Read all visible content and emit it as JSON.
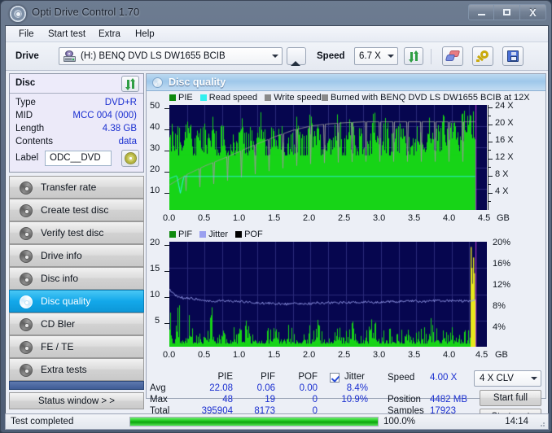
{
  "window": {
    "title": "Opti Drive Control 1.70",
    "icon": "disc-icon",
    "controls": {
      "minimize": "–",
      "maximize": "□",
      "close": "X"
    }
  },
  "menu": {
    "items": [
      "File",
      "Start test",
      "Extra",
      "Help"
    ]
  },
  "toolbar": {
    "drive_label": "Drive",
    "drive_value": "(H:)   BENQ DVD LS DW1655 BCIB",
    "eject_title": "Eject",
    "speed_label": "Speed",
    "speed_value": "6.7 X",
    "refresh_title": "Refresh",
    "erase_title": "Erase disc",
    "key_title": "Drive settings",
    "save_title": "Save"
  },
  "disc_panel": {
    "title": "Disc",
    "refresh_title": "Refresh disc info",
    "rows": [
      {
        "label": "Type",
        "value": "DVD+R"
      },
      {
        "label": "MID",
        "value": "MCC 004 (000)"
      },
      {
        "label": "Length",
        "value": "4.38 GB"
      },
      {
        "label": "Contents",
        "value": "data"
      }
    ],
    "label_caption": "Label",
    "label_value": "ODC__DVD",
    "disc_icon_title": "Disc icon"
  },
  "sidebar": {
    "items": [
      {
        "label": "Transfer rate",
        "selected": false
      },
      {
        "label": "Create test disc",
        "selected": false
      },
      {
        "label": "Verify test disc",
        "selected": false
      },
      {
        "label": "Drive info",
        "selected": false
      },
      {
        "label": "Disc info",
        "selected": false
      },
      {
        "label": "Disc quality",
        "selected": true
      },
      {
        "label": "CD Bler",
        "selected": false
      },
      {
        "label": "FE / TE",
        "selected": false
      },
      {
        "label": "Extra tests",
        "selected": false
      }
    ],
    "status_window_button": "Status window > >"
  },
  "panel": {
    "title": "Disc quality"
  },
  "stats": {
    "columns": [
      "PIE",
      "PIF",
      "POF",
      "Jitter"
    ],
    "jitter_checked": true,
    "rows": [
      {
        "label": "Avg",
        "values": [
          "22.08",
          "0.06",
          "0.00",
          "8.4%"
        ]
      },
      {
        "label": "Max",
        "values": [
          "48",
          "19",
          "0",
          "10.9%"
        ]
      },
      {
        "label": "Total",
        "values": [
          "395904",
          "8173",
          "0",
          ""
        ]
      }
    ],
    "info": [
      {
        "label": "Speed",
        "value": "4.00 X"
      },
      {
        "label": "Position",
        "value": "4482 MB"
      },
      {
        "label": "Samples",
        "value": "17923"
      }
    ],
    "speed_select": "4 X CLV",
    "start_full": "Start full",
    "start_part": "Start part"
  },
  "statusbar": {
    "message": "Test completed",
    "progress_text": "100.0%",
    "progress_value": 100,
    "time": "14:14"
  },
  "colors": {
    "pie": "#17d417",
    "read_speed": "#31f0ef",
    "write_speed": "#9a9a9a",
    "pif": "#17d417",
    "jitter": "#9aa0f0",
    "pof": "#000000",
    "plot_bg": "#06064f",
    "accent_blue": "#1a2fd0",
    "selection": "#13a8ea"
  },
  "chart_data": [
    {
      "type": "line",
      "title": "PIE / Read speed / Write speed",
      "legend": [
        {
          "name": "PIE",
          "color": "#17d417"
        },
        {
          "name": "Read speed",
          "color": "#31f0ef"
        },
        {
          "name": "Write speed",
          "color": "#9a9a9a"
        },
        {
          "name": "Burned with BENQ DVD LS DW1655 BCIB at 12X",
          "color": "#9a9a9a"
        }
      ],
      "xlabel": "GB",
      "x_ticks": [
        "0.0",
        "0.5",
        "1.0",
        "1.5",
        "2.0",
        "2.5",
        "3.0",
        "3.5",
        "4.0",
        "4.5"
      ],
      "xlim": [
        0,
        4.5
      ],
      "ylabel_left": "PIE",
      "y_ticks_left": [
        "10",
        "20",
        "30",
        "40",
        "50"
      ],
      "ylim_left": [
        0,
        50
      ],
      "ylabel_right": "Speed",
      "y_ticks_right": [
        "4 X",
        "8 X",
        "12 X",
        "16 X",
        "20 X",
        "24 X"
      ],
      "ylim_right": [
        0,
        25
      ],
      "grid": true,
      "series": [
        {
          "name": "PIE",
          "color": "#17d417",
          "x": [
            0.0,
            0.05,
            0.1,
            0.15,
            0.2,
            0.25,
            0.3,
            0.35,
            0.4,
            0.45,
            0.5,
            0.55,
            0.6,
            0.65,
            0.7,
            0.75,
            0.8,
            0.85,
            0.9,
            0.95,
            1.0,
            1.05,
            1.1,
            1.15,
            1.2,
            1.25,
            1.3,
            1.35,
            1.4,
            1.45,
            1.5,
            1.55,
            1.6,
            1.65,
            1.7,
            1.75,
            1.8,
            1.85,
            1.9,
            1.95,
            2.0,
            2.05,
            2.1,
            2.15,
            2.2,
            2.25,
            2.3,
            2.35,
            2.4,
            2.45,
            2.5,
            2.55,
            2.6,
            2.65,
            2.7,
            2.75,
            2.8,
            2.85,
            2.9,
            2.95,
            3.0,
            3.05,
            3.1,
            3.15,
            3.2,
            3.25,
            3.3,
            3.35,
            3.4,
            3.45,
            3.5,
            3.55,
            3.6,
            3.65,
            3.7,
            3.75,
            3.8,
            3.85,
            3.9,
            3.95,
            4.0,
            4.05,
            4.1,
            4.15,
            4.2,
            4.25,
            4.3,
            4.33
          ],
          "values": [
            34,
            38,
            33,
            36,
            31,
            41,
            35,
            30,
            37,
            33,
            39,
            32,
            44,
            34,
            30,
            38,
            33,
            31,
            36,
            29,
            41,
            34,
            32,
            38,
            30,
            35,
            42,
            33,
            29,
            37,
            31,
            40,
            34,
            28,
            36,
            33,
            39,
            31,
            35,
            30,
            43,
            33,
            37,
            29,
            34,
            38,
            31,
            36,
            42,
            33,
            30,
            37,
            35,
            32,
            39,
            34,
            28,
            36,
            41,
            33,
            30,
            38,
            35,
            31,
            37,
            34,
            40,
            32,
            36,
            30,
            39,
            35,
            33,
            41,
            36,
            32,
            38,
            34,
            43,
            37,
            35,
            40,
            36,
            44,
            39,
            42,
            48,
            45
          ]
        },
        {
          "name": "Read speed",
          "color": "#31f0ef",
          "x": [
            0.0,
            0.1,
            0.15,
            0.2,
            0.5,
            1.0,
            1.5,
            2.0,
            2.5,
            3.0,
            3.5,
            4.0,
            4.33
          ],
          "values": [
            7.5,
            8.2,
            4.0,
            8.0,
            8.0,
            8.0,
            8.0,
            8.0,
            8.0,
            8.0,
            8.0,
            8.0,
            8.0
          ]
        },
        {
          "name": "Write speed",
          "color": "#9a9a9a",
          "x": [
            0.0,
            0.25,
            0.5,
            0.75,
            1.0,
            1.25,
            1.5,
            1.75,
            2.0,
            2.25,
            2.5,
            2.75,
            3.0,
            3.25,
            3.5,
            3.75,
            4.0,
            4.33
          ],
          "values": [
            6.0,
            8.5,
            10.5,
            12.2,
            14.0,
            15.8,
            17.5,
            19.0,
            20.0,
            20.5,
            20.8,
            21.0,
            21.0,
            21.0,
            21.0,
            21.0,
            21.0,
            21.0
          ]
        }
      ]
    },
    {
      "type": "bar",
      "title": "PIF / Jitter / POF",
      "legend": [
        {
          "name": "PIF",
          "color": "#17d417"
        },
        {
          "name": "Jitter",
          "color": "#9aa0f0"
        },
        {
          "name": "POF",
          "color": "#000000"
        }
      ],
      "xlabel": "GB",
      "x_ticks": [
        "0.0",
        "0.5",
        "1.0",
        "1.5",
        "2.0",
        "2.5",
        "3.0",
        "3.5",
        "4.0",
        "4.5"
      ],
      "xlim": [
        0,
        4.5
      ],
      "ylabel_left": "PIF",
      "y_ticks_left": [
        "5",
        "10",
        "15",
        "20"
      ],
      "ylim_left": [
        0,
        20
      ],
      "ylabel_right": "Jitter",
      "y_ticks_right": [
        "4%",
        "8%",
        "12%",
        "16%",
        "20%"
      ],
      "ylim_right": [
        0,
        20
      ],
      "grid": true,
      "series": [
        {
          "name": "PIF",
          "color": "#17d417",
          "x": [
            0.0,
            0.05,
            0.1,
            0.13,
            0.15,
            0.2,
            0.25,
            0.3,
            0.33,
            0.4,
            0.45,
            0.5,
            0.55,
            0.6,
            0.63,
            0.7,
            0.75,
            0.8,
            0.85,
            0.9,
            0.95,
            1.0,
            1.05,
            1.1,
            1.15,
            1.2,
            1.25,
            1.3,
            1.35,
            1.4,
            1.45,
            1.5,
            1.55,
            1.6,
            1.65,
            1.7,
            1.75,
            1.8,
            1.85,
            1.9,
            1.95,
            2.0,
            2.05,
            2.1,
            2.15,
            2.2,
            2.25,
            2.3,
            2.35,
            2.4,
            2.45,
            2.5,
            2.55,
            2.6,
            2.65,
            2.7,
            2.75,
            2.8,
            2.85,
            2.9,
            2.95,
            3.0,
            3.05,
            3.1,
            3.15,
            3.2,
            3.25,
            3.3,
            3.35,
            3.4,
            3.45,
            3.5,
            3.55,
            3.6,
            3.65,
            3.7,
            3.75,
            3.8,
            3.85,
            3.9,
            3.95,
            4.0,
            4.05,
            4.1,
            4.15,
            4.2,
            4.25,
            4.3,
            4.32
          ],
          "values": [
            8,
            3,
            5,
            13,
            4,
            3,
            7,
            6,
            3,
            2,
            3,
            4,
            3,
            10,
            4,
            3,
            5,
            2,
            3,
            4,
            3,
            5,
            3,
            6,
            2,
            3,
            4,
            3,
            2,
            5,
            3,
            6,
            4,
            2,
            3,
            5,
            3,
            4,
            2,
            3,
            5,
            4,
            3,
            6,
            5,
            3,
            2,
            4,
            3,
            5,
            2,
            3,
            4,
            6,
            3,
            2,
            4,
            3,
            5,
            6,
            3,
            2,
            4,
            3,
            5,
            2,
            3,
            4,
            5,
            3,
            2,
            4,
            3,
            5,
            2,
            6,
            3,
            4,
            2,
            5,
            3,
            4,
            3,
            2,
            4,
            3,
            5,
            19,
            15
          ]
        },
        {
          "name": "Jitter",
          "color": "#9aa0f0",
          "x": [
            0.0,
            0.1,
            0.2,
            0.3,
            0.4,
            0.5,
            0.6,
            0.7,
            0.8,
            0.9,
            1.0,
            1.1,
            1.2,
            1.3,
            1.4,
            1.5,
            1.6,
            1.7,
            1.8,
            1.9,
            2.0,
            2.1,
            2.2,
            2.3,
            2.4,
            2.5,
            2.6,
            2.7,
            2.8,
            2.9,
            3.0,
            3.1,
            3.2,
            3.3,
            3.4,
            3.5,
            3.6,
            3.7,
            3.8,
            3.9,
            4.0,
            4.1,
            4.2,
            4.3,
            4.33
          ],
          "values": [
            10.8,
            9.6,
            9.3,
            9.2,
            9.0,
            8.8,
            8.5,
            8.8,
            8.7,
            8.6,
            8.6,
            8.5,
            8.4,
            8.3,
            8.3,
            8.2,
            8.2,
            8.1,
            8.2,
            8.2,
            8.2,
            8.4,
            8.3,
            8.4,
            8.4,
            8.4,
            8.5,
            8.5,
            8.5,
            8.4,
            8.5,
            8.6,
            8.6,
            8.6,
            8.8,
            8.7,
            8.6,
            8.7,
            8.8,
            8.7,
            8.8,
            8.7,
            8.7,
            8.9,
            8.8
          ]
        },
        {
          "name": "POF",
          "color": "#000000",
          "x": [],
          "values": []
        }
      ]
    }
  ]
}
